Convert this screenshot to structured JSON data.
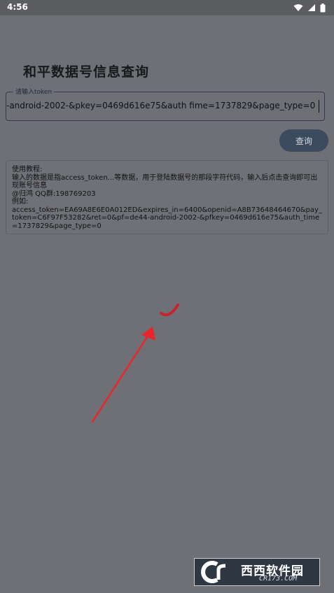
{
  "status_bar": {
    "time": "4:56"
  },
  "page_title": "和平数据号信息查询",
  "token_input": {
    "label": "请输入token",
    "value": "-android-2002-&pkey=0469d616e75&auth fime=1737829&page_type=0"
  },
  "query_button": {
    "label": "查询"
  },
  "tutorial": {
    "lines": [
      "使用教程:",
      "输入的数据是指access_token...等数据，用于登陆数据号的那段字符代码，输入后点击查询即可出现账号信息",
      "@归鸿  QQ群:198769203",
      "例如:",
      "access_token=EA69A8E6E0A012ED&expires_in=6400&openid=A8B73648464670&pay_token=C6F97F53282&ret=0&pf=de44-android-2002-&pfkey=0469d616e75&auth_time=1737829&page_type=0"
    ]
  },
  "watermark": {
    "text": "西西软件园",
    "url": "CR173.COM"
  },
  "colors": {
    "accent": "#2b3d55",
    "button": "#3c4a5e",
    "annotation_arrow": "#e8262a"
  }
}
